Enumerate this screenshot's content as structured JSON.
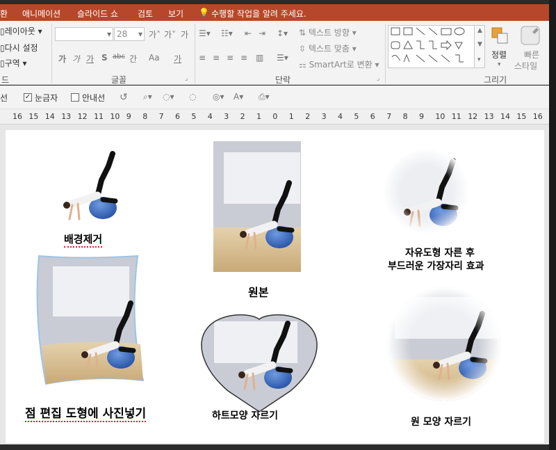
{
  "menu": {
    "partial_first": "환",
    "tabs": [
      "애니메이션",
      "슬라이드 쇼",
      "검토",
      "보기"
    ],
    "tell_me": "수행할 작업을 알려 주세요."
  },
  "ribbon": {
    "slides": {
      "layout": "레이아웃",
      "reset": "다시 설정",
      "section": "구역",
      "label": "드"
    },
    "font": {
      "size": "28",
      "label": "글꼴",
      "grow": "가˄",
      "shrink": "가˅",
      "clear": "가",
      "bold": "가",
      "italic": "가",
      "underline": "가",
      "shadow": "S",
      "strike": "abc",
      "spacing": "간",
      "case": "Aa",
      "color": "가"
    },
    "paragraph": {
      "label": "단락",
      "text_direction": "텍스트 방향",
      "align_text": "텍스트 맞춤",
      "smartart": "SmartArt로 변환"
    },
    "drawing": {
      "label": "그리기",
      "arrange": "정렬",
      "quick_styles_1": "빠른",
      "quick_styles_2": "스타일"
    }
  },
  "viewbar": {
    "partial": "선",
    "gridlines": "눈금자",
    "guides": "안내선",
    "gridlines_checked": true,
    "guides_checked": false
  },
  "ruler": [
    "16",
    "15",
    "14",
    "13",
    "12",
    "11",
    "10",
    "9",
    "8",
    "7",
    "6",
    "5",
    "4",
    "3",
    "2",
    "1",
    "0",
    "1",
    "2",
    "3",
    "4",
    "5",
    "6",
    "7",
    "8",
    "9",
    "10",
    "11",
    "12",
    "13",
    "14",
    "15",
    "16"
  ],
  "slide": {
    "cap_bg_removed": "배경제거",
    "cap_original": "원본",
    "cap_freeform_1": "자유도형 자른 후",
    "cap_freeform_2": "부드러운 가장자리 효과",
    "cap_edit_points": "점 편집 도형에 사진넣기",
    "cap_heart": "하트모양 자르기",
    "cap_circle": "원 모양 자르기"
  },
  "colors": {
    "accent": "#b7472a",
    "ball": "#3c6fc4",
    "wall": "#c9ccd4",
    "floor": "#d8c39a"
  }
}
